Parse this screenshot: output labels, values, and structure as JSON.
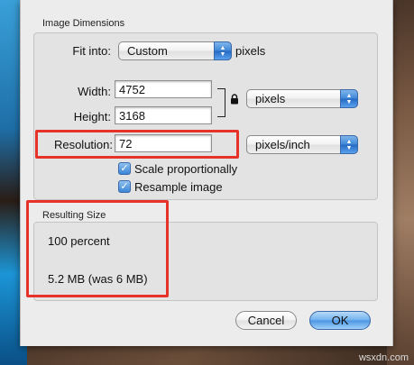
{
  "dialog": {
    "image_dimensions": {
      "title": "Image Dimensions",
      "fit_into_label": "Fit into:",
      "fit_into_value": "Custom",
      "fit_into_unit": "pixels",
      "width_label": "Width:",
      "width_value": "4752",
      "height_label": "Height:",
      "height_value": "3168",
      "size_unit": "pixels",
      "resolution_label": "Resolution:",
      "resolution_value": "72",
      "resolution_unit": "pixels/inch",
      "scale_label": "Scale proportionally",
      "scale_checked": true,
      "resample_label": "Resample image",
      "resample_checked": true
    },
    "resulting_size": {
      "title": "Resulting Size",
      "percent": "100 percent",
      "size": "5.2 MB (was 6 MB)"
    },
    "buttons": {
      "cancel": "Cancel",
      "ok": "OK"
    }
  },
  "icons": {
    "checkmark": "✓",
    "popup_arrows": "▲▼",
    "lock": "lock-icon"
  },
  "colors": {
    "highlight": "#e5332a",
    "accent": "#3c86d6"
  },
  "watermark": "wsxdn.com"
}
